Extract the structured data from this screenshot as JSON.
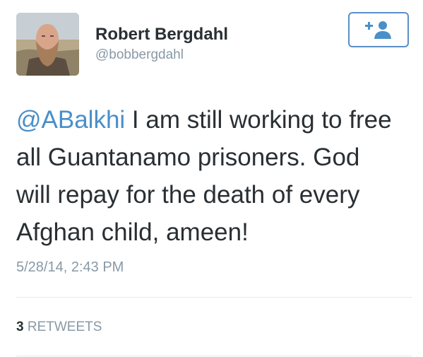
{
  "user": {
    "display_name": "Robert Bergdahl",
    "screen_name": "@bobbergdahl"
  },
  "follow_button": {
    "icon": "add-user-icon",
    "color": "#4a8fc9"
  },
  "tweet": {
    "mention": "@ABalkhi",
    "lines": [
      " I am still working to free",
      "all Guantanamo prisoners. God",
      "will repay for the death of every",
      "Afghan child, ameen!"
    ],
    "timestamp": "5/28/14, 2:43 PM"
  },
  "stats": {
    "retweet_count": "3",
    "retweet_label": "RETWEETS"
  },
  "colors": {
    "link": "#4a8fc9",
    "muted": "#8899a6",
    "text": "#292f33",
    "divider": "#e1e8ed"
  }
}
